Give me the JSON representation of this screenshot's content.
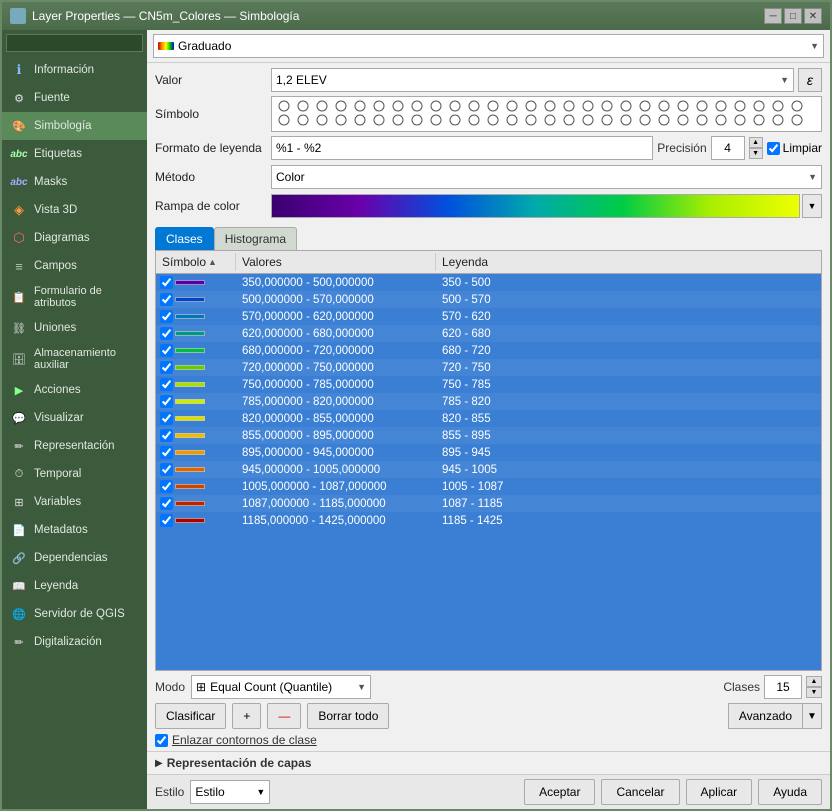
{
  "window": {
    "title": "Layer Properties — CN5m_Colores — Simbología",
    "close_btn": "✕",
    "minimize_btn": "─",
    "maximize_btn": "□"
  },
  "sidebar": {
    "search_placeholder": "",
    "items": [
      {
        "id": "informacion",
        "label": "Información",
        "icon": "ℹ"
      },
      {
        "id": "fuente",
        "label": "Fuente",
        "icon": "🔧"
      },
      {
        "id": "simbologia",
        "label": "Simbología",
        "icon": "🎨",
        "active": true
      },
      {
        "id": "etiquetas",
        "label": "Etiquetas",
        "icon": "abc"
      },
      {
        "id": "masks",
        "label": "Masks",
        "icon": "abc"
      },
      {
        "id": "vista3d",
        "label": "Vista 3D",
        "icon": "◈"
      },
      {
        "id": "diagramas",
        "label": "Diagramas",
        "icon": "⬡"
      },
      {
        "id": "campos",
        "label": "Campos",
        "icon": "≡"
      },
      {
        "id": "formulario",
        "label": "Formulario de atributos",
        "icon": "📋"
      },
      {
        "id": "uniones",
        "label": "Uniones",
        "icon": "⛓"
      },
      {
        "id": "almacenamiento",
        "label": "Almacenamiento auxiliar",
        "icon": "🗄"
      },
      {
        "id": "acciones",
        "label": "Acciones",
        "icon": "▶"
      },
      {
        "id": "visualizar",
        "label": "Visualizar",
        "icon": "💬"
      },
      {
        "id": "representacion",
        "label": "Representación",
        "icon": "✏"
      },
      {
        "id": "temporal",
        "label": "Temporal",
        "icon": "⏱"
      },
      {
        "id": "variables",
        "label": "Variables",
        "icon": "⊞"
      },
      {
        "id": "metadatos",
        "label": "Metadatos",
        "icon": "📄"
      },
      {
        "id": "dependencias",
        "label": "Dependencias",
        "icon": "🔗"
      },
      {
        "id": "leyenda",
        "label": "Leyenda",
        "icon": "📖"
      },
      {
        "id": "servidor",
        "label": "Servidor de QGIS",
        "icon": "🌐"
      },
      {
        "id": "digitalizacion",
        "label": "Digitalización",
        "icon": "✏"
      }
    ]
  },
  "panel": {
    "type_label": "Graduado",
    "valor_label": "Valor",
    "valor_value": "1,2 ELEV",
    "epsilon_btn": "ε",
    "simbolo_label": "Símbolo",
    "formato_label": "Formato de leyenda",
    "formato_value": "%1 - %2",
    "precision_label": "Precisión 4",
    "precision_value": "4",
    "limpiar_label": "Limpiar",
    "metodo_label": "Método",
    "metodo_value": "Color",
    "rampa_label": "Rampa de color",
    "tabs": [
      {
        "id": "clases",
        "label": "Clases",
        "active": true
      },
      {
        "id": "histograma",
        "label": "Histograma"
      }
    ],
    "table": {
      "headers": [
        "Símbolo",
        "Valores",
        "Leyenda"
      ],
      "rows": [
        {
          "checked": true,
          "color": "#5500aa",
          "values": "350,000000 - 500,000000",
          "legend": "350 - 500"
        },
        {
          "checked": true,
          "color": "#0044cc",
          "values": "500,000000 - 570,000000",
          "legend": "500 - 570"
        },
        {
          "checked": true,
          "color": "#0077bb",
          "values": "570,000000 - 620,000000",
          "legend": "570 - 620"
        },
        {
          "checked": true,
          "color": "#009988",
          "values": "620,000000 - 680,000000",
          "legend": "620 - 680"
        },
        {
          "checked": true,
          "color": "#00bb44",
          "values": "680,000000 - 720,000000",
          "legend": "680 - 720"
        },
        {
          "checked": true,
          "color": "#66cc00",
          "values": "720,000000 - 750,000000",
          "legend": "720 - 750"
        },
        {
          "checked": true,
          "color": "#aadd00",
          "values": "750,000000 - 785,000000",
          "legend": "750 - 785"
        },
        {
          "checked": true,
          "color": "#ccee00",
          "values": "785,000000 - 820,000000",
          "legend": "785 - 820"
        },
        {
          "checked": true,
          "color": "#dddd00",
          "values": "820,000000 - 855,000000",
          "legend": "820 - 855"
        },
        {
          "checked": true,
          "color": "#eebb00",
          "values": "855,000000 - 895,000000",
          "legend": "855 - 895"
        },
        {
          "checked": true,
          "color": "#ee9900",
          "values": "895,000000 - 945,000000",
          "legend": "895 - 945"
        },
        {
          "checked": true,
          "color": "#dd6600",
          "values": "945,000000 - 1005,000000",
          "legend": "945 - 1005"
        },
        {
          "checked": true,
          "color": "#cc4400",
          "values": "1005,000000 - 1087,000000",
          "legend": "1005 - 1087"
        },
        {
          "checked": true,
          "color": "#bb2200",
          "values": "1087,000000 - 1185,000000",
          "legend": "1087 - 1185"
        },
        {
          "checked": true,
          "color": "#aa0000",
          "values": "1185,000000 - 1425,000000",
          "legend": "1185 - 1425"
        }
      ]
    },
    "modo_label": "Modo",
    "modo_value": "Equal Count (Quantile)",
    "modo_icon": "⊞",
    "clases_label": "Clases",
    "clases_value": "15",
    "clasificar_btn": "Clasificar",
    "add_btn": "+",
    "delete_btn": "—",
    "borrar_todo_btn": "Borrar todo",
    "avanzado_btn": "Avanzado",
    "link_check_label": "Enlazar contornos de clase",
    "repr_title": "Representación de capas",
    "footer": {
      "estilo_label": "Estilo",
      "estilo_value": "Estilo",
      "aceptar_btn": "Aceptar",
      "cancelar_btn": "Cancelar",
      "aplicar_btn": "Aplicar",
      "ayuda_btn": "Ayuda"
    }
  }
}
